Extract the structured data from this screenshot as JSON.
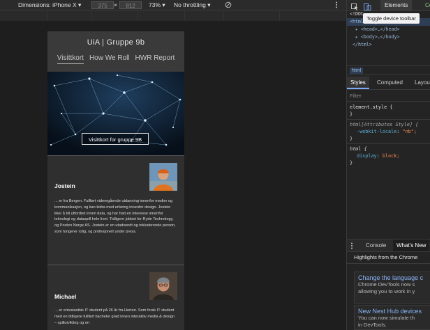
{
  "device_toolbar": {
    "dimensions_label": "Dimensions: iPhone X ▾",
    "width_value": "375",
    "times": "×",
    "height_value": "812",
    "zoom": "73% ▾",
    "throttling": "No throttling ▾"
  },
  "page": {
    "brand": "UiA | Gruppe 9b",
    "nav": [
      "Visittkort",
      "How We Roll",
      "HWR Report"
    ],
    "hero_button": "Visittkort for gruppe 9B",
    "members": [
      {
        "name": "Jostein",
        "bio": "... er fra Bergen. Fullført videregående utdanning innenfor medier og kommunikasjon, og kan bidra med erfaring innenfor design. Jostein liker å bli utfordret innen data, og har hatt en interesse innenfor teknologi og dataspill hele livet. Tidligere jobbet for Ryde Technology, og Posten Norge AS. Jostein er en utadvendt og inkluderende person, som fungerer rolig, og profesjonelt under press."
      },
      {
        "name": "Michael",
        "bio": "... er entusiastisk IT student på 26 år fra Horten. Som forsk IT student med en tidligere fullført bachelor grad innen interaktiv media & design – spillutvikling og en"
      }
    ]
  },
  "devtools": {
    "tabs": [
      "Elements",
      "Co"
    ],
    "tooltip": "Toggle device toolbar",
    "dom_lines": [
      "<!DOC",
      "<html lang=\"nb\"> == $0",
      "▸ <head>…</head>",
      "▸ <body>…</body>",
      "</html>"
    ],
    "breadcrumb": "html",
    "styles_tabs": [
      "Styles",
      "Computed",
      "Layou"
    ],
    "filter_placeholder": "Filter",
    "rules": {
      "element_style": "element.style {",
      "attr_selector": "html[Attributes Style] {",
      "attr_prop": "-webkit-locale",
      "attr_val": "\"nb\";",
      "html_selector": "html {",
      "display_prop": "display",
      "display_val": "block;",
      "close": "}"
    },
    "drawer_tabs": [
      "Console",
      "What's New"
    ],
    "highlights": "Highlights from the Chrome",
    "news": [
      {
        "title": "Change the language c",
        "desc1": "Chrome DevTools now s",
        "desc2": "allowing you to work in y"
      },
      {
        "title": "New Nest Hub devices",
        "desc1": "You can now simulate th",
        "desc2": "in DevTools."
      }
    ]
  },
  "colors": {
    "accent": "#7cacf8",
    "link": "#8ab4f8"
  }
}
